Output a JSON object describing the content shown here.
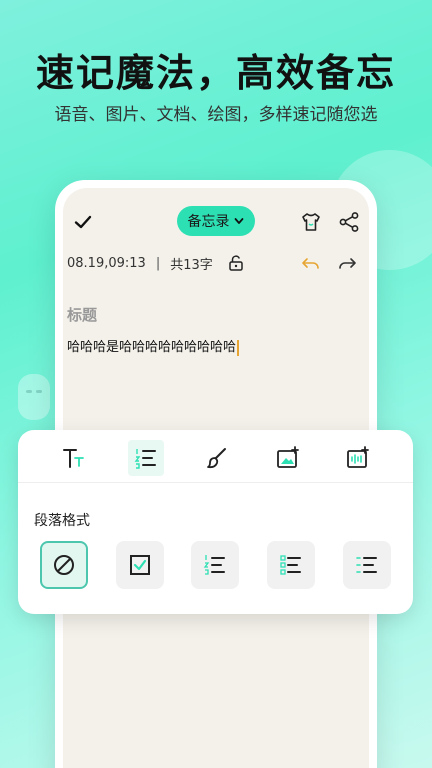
{
  "promo": {
    "headline": "速记魔法，高效备忘",
    "subline": "语音、图片、文档、绘图，多样速记随您选"
  },
  "editor": {
    "memo_label": "备忘录",
    "date": "08.19,09:13",
    "separator": "|",
    "count": "共13字",
    "title_placeholder": "标题",
    "body": "哈哈哈是哈哈哈哈哈哈哈哈哈"
  },
  "panel": {
    "section_label": "段落格式",
    "tools": [
      "text-size-icon",
      "list-format-icon",
      "brush-icon",
      "image-icon",
      "audio-icon"
    ],
    "formats": [
      "none-icon",
      "checkbox-icon",
      "numbered-list-icon",
      "bulleted-list-icon",
      "dash-list-icon"
    ]
  },
  "colors": {
    "accent": "#2de0b4",
    "active_border": "#4cc7ae",
    "undo": "#e6a532"
  }
}
